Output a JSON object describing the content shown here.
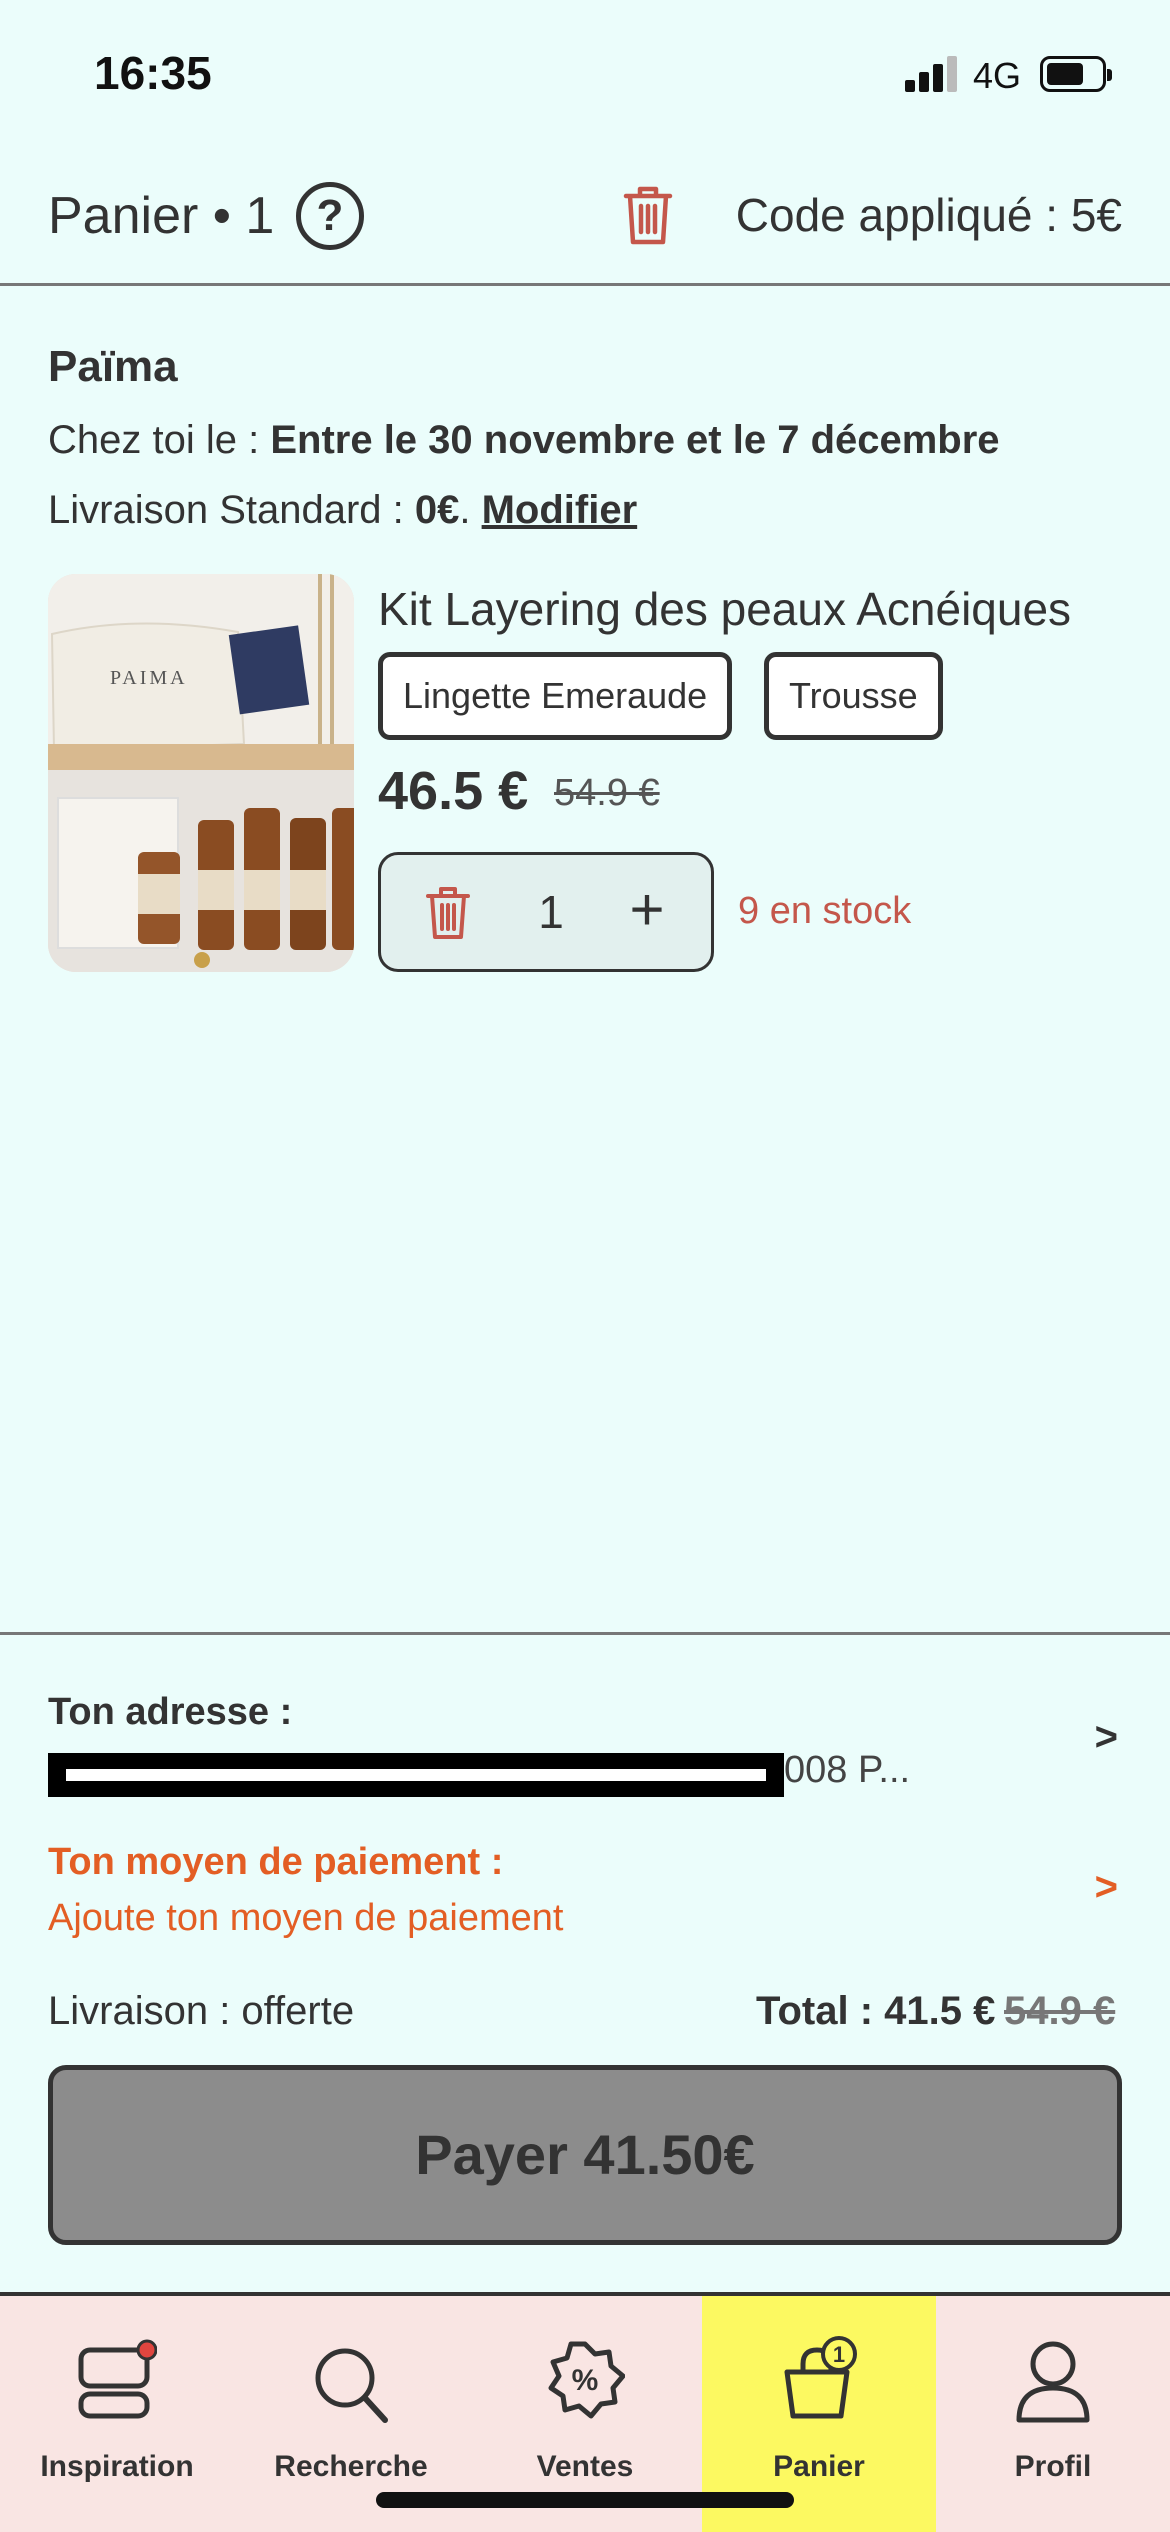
{
  "status_bar": {
    "time": "16:35",
    "network": "4G"
  },
  "header": {
    "title": "Panier • 1",
    "help_symbol": "?",
    "code_text": "Code appliqué : 5€"
  },
  "seller": {
    "name": "Païma",
    "delivery_prefix": "Chez toi le : ",
    "delivery_dates": "Entre le 30 novembre et le 7 décembre",
    "shipping_prefix": "Livraison Standard : ",
    "shipping_cost": "0€",
    "shipping_sep": ". ",
    "modify_label": "Modifier"
  },
  "product": {
    "title": "Kit Layering des peaux Acnéiques",
    "options": [
      "Lingette Emeraude",
      "Trousse"
    ],
    "price": "46.5 €",
    "old_price": "54.9 €",
    "quantity": "1",
    "plus_symbol": "+",
    "stock": "9 en stock",
    "image_brand": "PAIMA"
  },
  "checkout": {
    "address_label": "Ton adresse :",
    "address_tail": "008 P...",
    "arrow": ">",
    "payment_label": "Ton moyen de paiement :",
    "payment_add": "Ajoute ton moyen de paiement",
    "shipping": "Livraison : offerte",
    "total": "Total : 41.5 €",
    "total_old": "54.9 €",
    "pay_button": "Payer 41.50€"
  },
  "tabs": [
    {
      "label": "Inspiration",
      "icon": "inspiration-icon"
    },
    {
      "label": "Recherche",
      "icon": "search-icon"
    },
    {
      "label": "Ventes",
      "icon": "percent-badge-icon"
    },
    {
      "label": "Panier",
      "icon": "bag-icon",
      "badge": "1",
      "active": true
    },
    {
      "label": "Profil",
      "icon": "profile-icon"
    }
  ],
  "colors": {
    "background": "#ebfdfb",
    "accent_orange": "#e35e24",
    "stock_red": "#c4574b",
    "active_tab": "#fcf961",
    "tabbar": "#f9e5e3"
  }
}
